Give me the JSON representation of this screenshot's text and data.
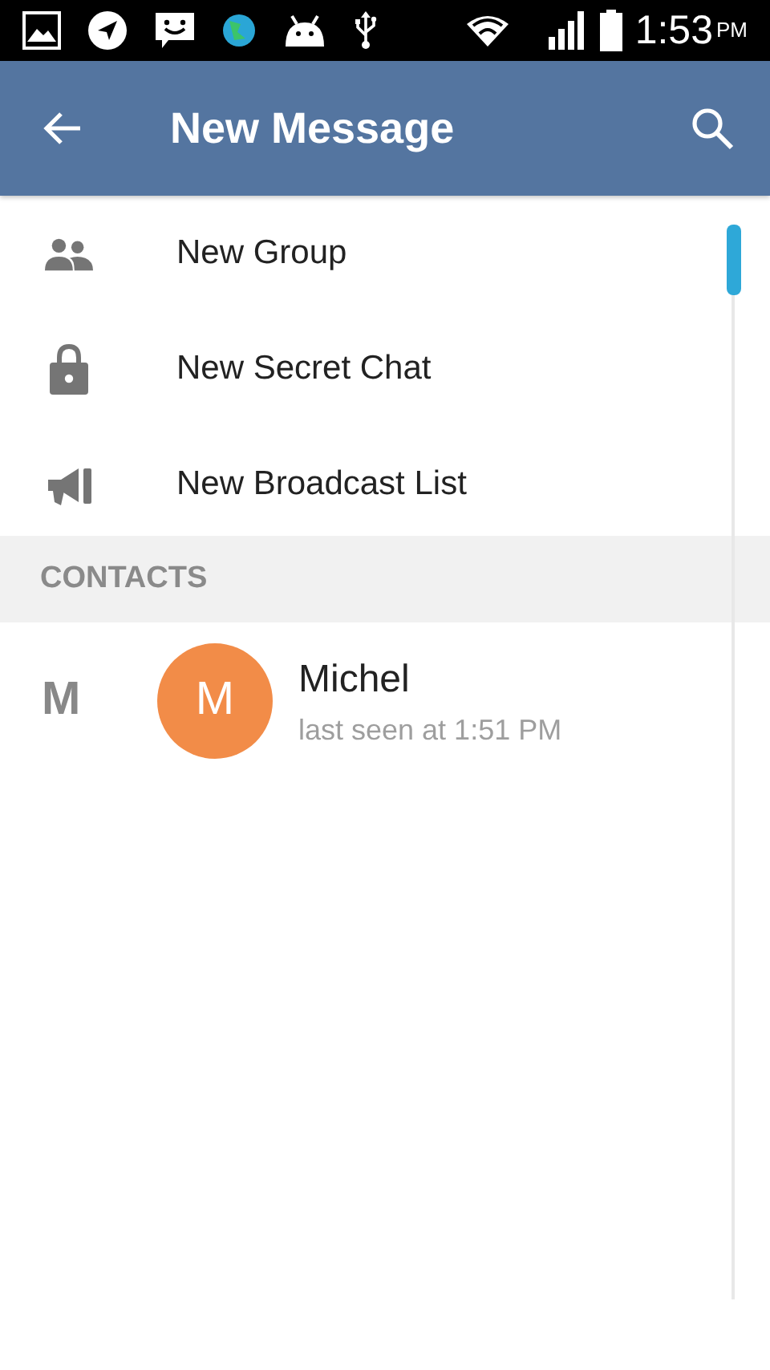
{
  "status_bar": {
    "time": "1:53",
    "ampm": "PM"
  },
  "app_bar": {
    "title": "New Message"
  },
  "menu_items": [
    {
      "kind": "group",
      "label": "New Group"
    },
    {
      "kind": "lock",
      "label": "New Secret Chat"
    },
    {
      "kind": "broadcast",
      "label": "New Broadcast List"
    }
  ],
  "contacts_header": "CONTACTS",
  "contacts": [
    {
      "section_letter": "M",
      "avatar_letter": "M",
      "color": "#f28c48",
      "name": "Michel",
      "status": "last seen at 1:51 PM"
    }
  ]
}
